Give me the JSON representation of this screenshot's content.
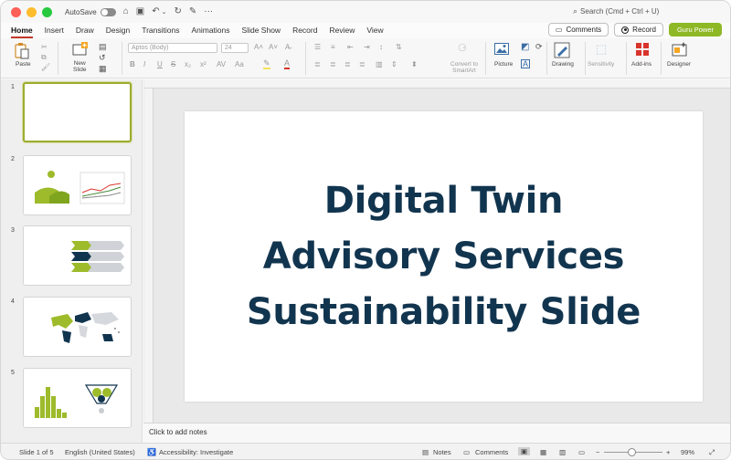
{
  "titlebar": {
    "autosave_label": "AutoSave",
    "search_placeholder": "Search (Cmd + Ctrl + U)"
  },
  "tabs": [
    "Home",
    "Insert",
    "Draw",
    "Design",
    "Transitions",
    "Animations",
    "Slide Show",
    "Record",
    "Review",
    "View"
  ],
  "active_tab": "Home",
  "tab_actions": {
    "comments_label": "Comments",
    "record_label": "Record",
    "addin_label": "Guru Power"
  },
  "ribbon": {
    "paste_label": "Paste",
    "new_slide_label": "New\nSlide",
    "font_name": "Aptos (Body)",
    "font_size": "24",
    "convert_label": "Convert to SmartArt",
    "picture_label": "Picture",
    "drawing_label": "Drawing",
    "sensitivity_label": "Sensitivity",
    "addins_label": "Add-ins",
    "designer_label": "Designer"
  },
  "slides_panel": {
    "numbers": [
      "1",
      "2",
      "3",
      "4",
      "5"
    ],
    "selected": "1"
  },
  "slide": {
    "line1": "Digital Twin",
    "line2": "Advisory Services",
    "line3": "Sustainability Slide",
    "title_color": "#12354f"
  },
  "notes": {
    "placeholder": "Click to add notes"
  },
  "statusbar": {
    "slide_counter": "Slide 1 of 5",
    "language": "English (United States)",
    "accessibility": "Accessibility: Investigate",
    "notes_label": "Notes",
    "comments_label": "Comments",
    "zoom": "99%"
  },
  "colors": {
    "accent_green": "#8eb826",
    "tab_underline": "#c0392b",
    "thumb_selected_border": "#9dac2f"
  }
}
